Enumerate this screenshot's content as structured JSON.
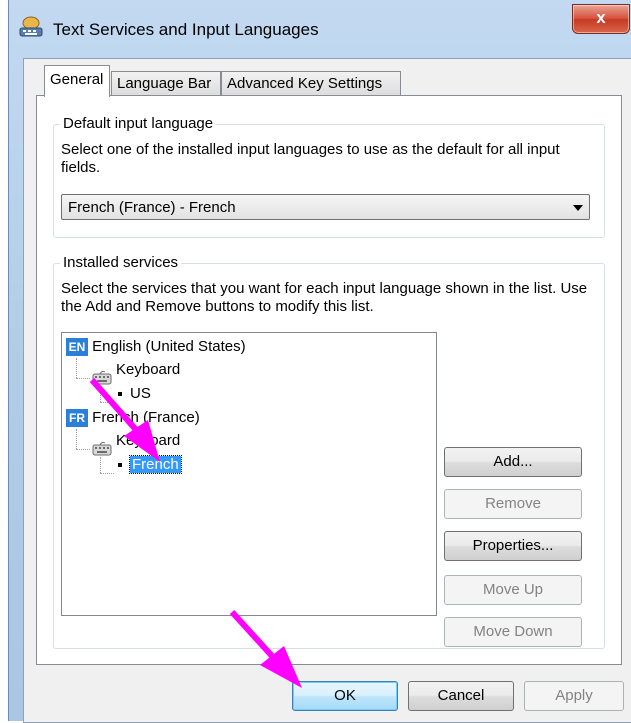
{
  "window": {
    "title": "Text Services and Input Languages",
    "close_glyph": "x"
  },
  "tabs": [
    {
      "label": "General",
      "active": true
    },
    {
      "label": "Language Bar",
      "active": false
    },
    {
      "label": "Advanced Key Settings",
      "active": false
    }
  ],
  "default_input": {
    "legend": "Default input language",
    "description": "Select one of the installed input languages to use as the default for all input fields.",
    "selected": "French (France) - French"
  },
  "installed_services": {
    "legend": "Installed services",
    "description": "Select the services that you want for each input language shown in the list. Use the Add and Remove buttons to modify this list.",
    "tree": [
      {
        "badge": "EN",
        "language": "English (United States)",
        "category": "Keyboard",
        "layout": "US",
        "selected": false
      },
      {
        "badge": "FR",
        "language": "French (France)",
        "category": "Keyboard",
        "layout": "French",
        "selected": true
      }
    ],
    "buttons": {
      "add": {
        "label": "Add...",
        "enabled": true
      },
      "remove": {
        "label": "Remove",
        "enabled": false
      },
      "properties": {
        "label": "Properties...",
        "enabled": true
      },
      "move_up": {
        "label": "Move Up",
        "enabled": false
      },
      "move_down": {
        "label": "Move Down",
        "enabled": false
      }
    }
  },
  "footer": {
    "ok": "OK",
    "cancel": "Cancel",
    "apply": "Apply"
  },
  "colors": {
    "annotation_arrow": "#ff00ff",
    "selection": "#3399ff",
    "lang_badge": "#2b7fd9"
  }
}
